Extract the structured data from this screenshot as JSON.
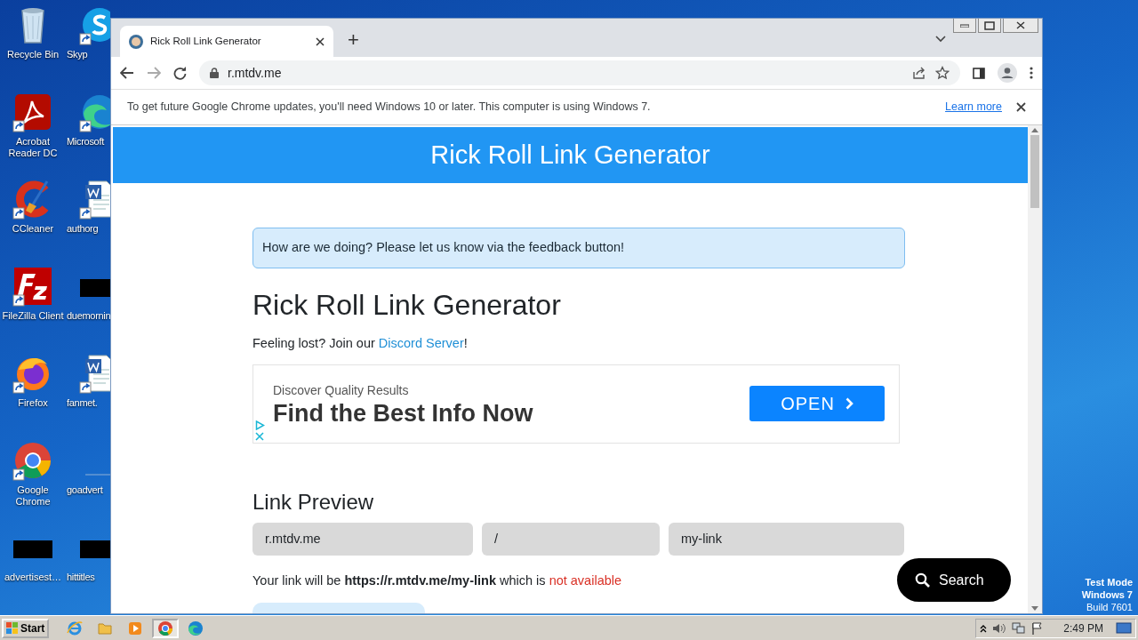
{
  "desktop": {
    "icons": [
      {
        "label": "Recycle Bin",
        "kind": "recycle",
        "shortcut": false
      },
      {
        "label": "Skyp",
        "kind": "skype",
        "shortcut": true
      },
      {
        "label": "Acrobat Reader DC",
        "kind": "acrobat",
        "shortcut": true
      },
      {
        "label": "Microsoft",
        "kind": "edge",
        "shortcut": true
      },
      {
        "label": "CCleaner",
        "kind": "ccleaner",
        "shortcut": true
      },
      {
        "label": "authorg",
        "kind": "word",
        "shortcut": true
      },
      {
        "label": "FileZilla Client",
        "kind": "filezilla",
        "shortcut": true
      },
      {
        "label": "duemornin",
        "kind": "redacted",
        "shortcut": false
      },
      {
        "label": "Firefox",
        "kind": "firefox",
        "shortcut": true
      },
      {
        "label": "fanmet.",
        "kind": "word",
        "shortcut": true
      },
      {
        "label": "Google Chrome",
        "kind": "chrome",
        "shortcut": true
      },
      {
        "label": "goadvert",
        "kind": "blank",
        "shortcut": false
      },
      {
        "label": "advertisest…",
        "kind": "redacted",
        "shortcut": false
      },
      {
        "label": "hittitles",
        "kind": "redacted",
        "shortcut": false
      }
    ],
    "notice": [
      "Test Mode",
      "Windows 7",
      "Build 7601"
    ]
  },
  "browser": {
    "tab": {
      "title": "Rick Roll Link Generator",
      "selected": true
    },
    "new_tab": "+",
    "address": "r.mtdv.me",
    "infobar": {
      "message": "To get future Google Chrome updates, you'll need Windows 10 or later. This computer is using Windows 7.",
      "link": "Learn more"
    }
  },
  "page": {
    "header": "Rick Roll Link Generator",
    "alert": "How are we doing? Please let us know via the feedback button!",
    "title": "Rick Roll Link Generator",
    "intro": {
      "before": "Feeling lost? Join our ",
      "link": "Discord Server",
      "after": "!"
    },
    "ad": {
      "eyebrow": "Discover Quality Results",
      "headline": "Find the Best Info Now",
      "button": "OPEN"
    },
    "preview": {
      "heading": "Link Preview",
      "fields": [
        {
          "value": "r.mtdv.me"
        },
        {
          "value": "/"
        },
        {
          "value": "my-link"
        }
      ],
      "result": {
        "text": "Your link will be **https://r.mtdv.me/my-link** which is ",
        "status": "not available"
      }
    },
    "search_button": "Search"
  },
  "taskbar": {
    "start": "Start",
    "apps": [
      {
        "kind": "ie",
        "selected": false
      },
      {
        "kind": "folder",
        "selected": false
      },
      {
        "kind": "media",
        "selected": false
      },
      {
        "kind": "chrome",
        "selected": true
      },
      {
        "kind": "edge",
        "selected": false
      }
    ],
    "clock": "2:49 PM"
  }
}
